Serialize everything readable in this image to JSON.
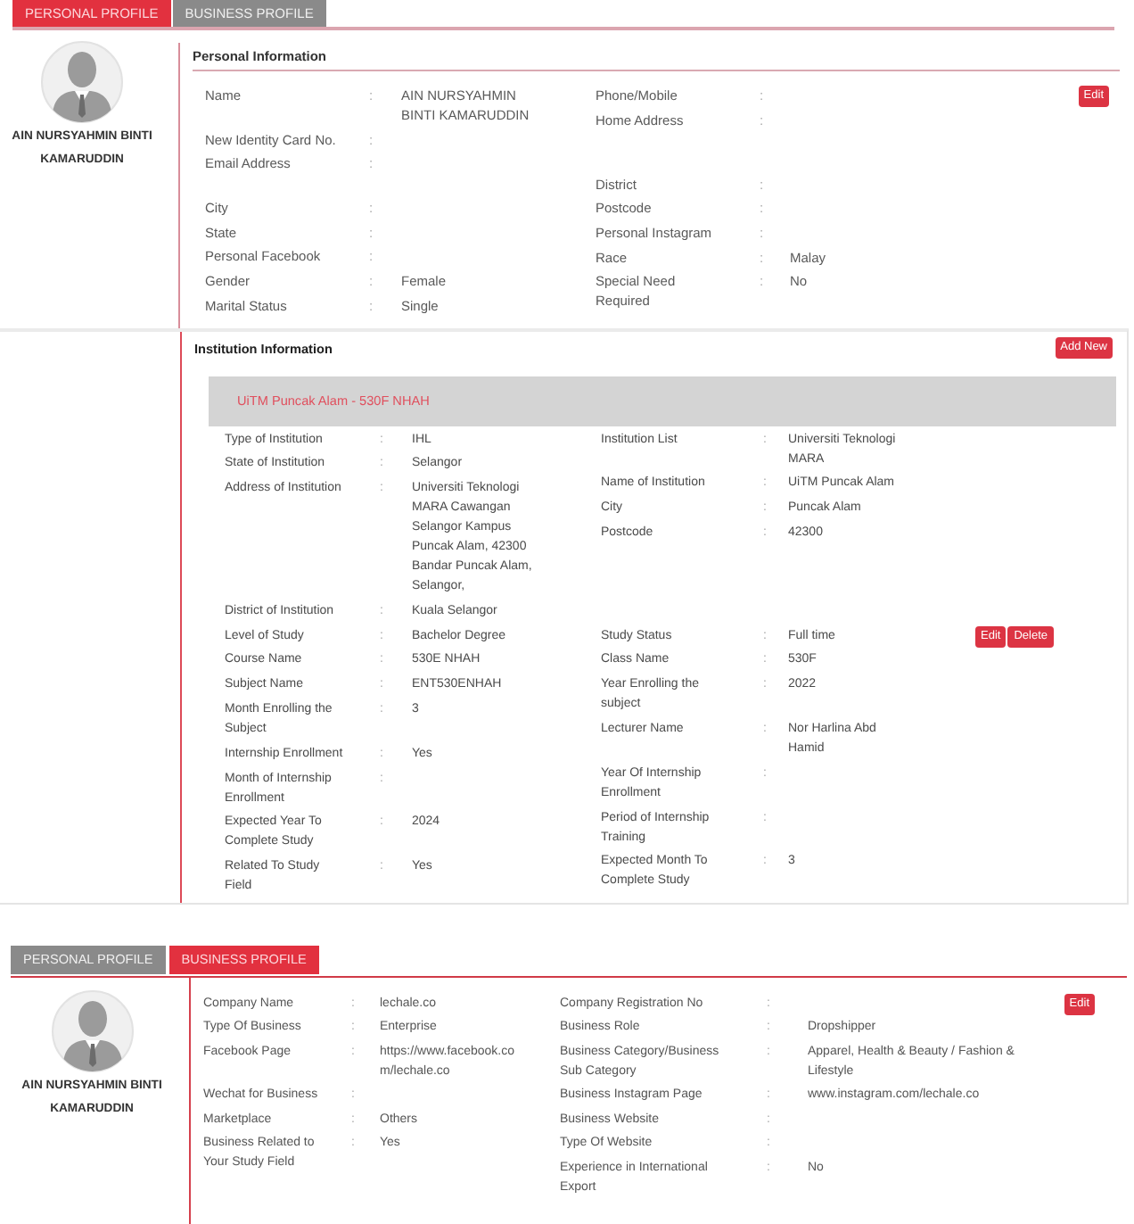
{
  "personal_profile": {
    "tabs": [
      {
        "label": "PERSONAL PROFILE",
        "selected": true
      },
      {
        "label": "BUSINESS PROFILE",
        "selected": false
      }
    ],
    "profile_name": "AIN NURSYAHMIN BINTI KAMARUDDIN",
    "section_title": "Personal Information",
    "edit_button": "Edit",
    "left_fields": [
      {
        "label": "Name",
        "sep": ":",
        "value": "AIN NURSYAHMIN BINTI KAMARUDDIN"
      },
      {
        "label": "New Identity Card No.",
        "sep": ":"
      },
      {
        "label": "Email Address",
        "sep": ":"
      },
      {
        "label": "City",
        "sep": ":"
      },
      {
        "label": "State",
        "sep": ":"
      },
      {
        "label": "Personal Facebook",
        "sep": ":"
      },
      {
        "label": "Gender",
        "sep": ":",
        "value": "Female"
      },
      {
        "label": "Marital Status",
        "sep": ":",
        "value": "Single"
      }
    ],
    "right_fields": [
      {
        "label": "Phone/Mobile",
        "sep": ":"
      },
      {
        "label": "Home Address",
        "sep": ":"
      },
      {
        "label": "District",
        "sep": ":"
      },
      {
        "label": "Postcode",
        "sep": ":"
      },
      {
        "label": "Personal Instagram",
        "sep": ":"
      },
      {
        "label": "Race",
        "sep": ":",
        "value": "Malay"
      },
      {
        "label": "Special Need Required",
        "sep": ":",
        "value": "No"
      }
    ]
  },
  "institution_information": {
    "title": "Institution Information",
    "add_button": "Add New",
    "record": {
      "heading": "UiTM Puncak Alam - 530F NHAH",
      "blocks": [
        {
          "left_fields": [
            {
              "label": "Type of Institution",
              "sep": ":",
              "value": "IHL"
            },
            {
              "label": "State of Institution",
              "sep": ":",
              "value": "Selangor"
            },
            {
              "label": "Address of Institution",
              "sep": ":",
              "value": "Universiti Teknologi MARA Cawangan Selangor Kampus Puncak Alam, 42300 Bandar Puncak Alam, Selangor,"
            },
            {
              "label": "District of Institution",
              "sep": ":",
              "value": "Kuala Selangor"
            }
          ],
          "right_fields": [
            {
              "label": "Institution List",
              "sep": ":",
              "value": "Universiti Teknologi MARA"
            },
            {
              "label": "Name of Institution",
              "sep": ":",
              "value": "UiTM Puncak Alam"
            },
            {
              "label": "City",
              "sep": ":",
              "value": "Puncak Alam"
            },
            {
              "label": "Postcode",
              "sep": ":",
              "value": "42300"
            }
          ]
        },
        {
          "left_fields": [
            {
              "label": "Level of Study",
              "sep": ":",
              "value": "Bachelor Degree"
            },
            {
              "label": "Course Name",
              "sep": ":",
              "value": "530E NHAH"
            },
            {
              "label": "Subject Name",
              "sep": ":",
              "value": "ENT530ENHAH"
            },
            {
              "label": "Month Enrolling the Subject",
              "sep": ":",
              "value": "3"
            },
            {
              "label": "Internship Enrollment",
              "sep": ":",
              "value": "Yes"
            },
            {
              "label": "Month of Internship Enrollment",
              "sep": ":"
            },
            {
              "label": "Expected Year To Complete Study",
              "sep": ":",
              "value": "2024"
            },
            {
              "label": "Related To Study Field",
              "sep": ":",
              "value": "Yes"
            }
          ],
          "right_fields": [
            {
              "label": "Study Status",
              "sep": ":",
              "value": "Full time"
            },
            {
              "label": "Class Name",
              "sep": ":",
              "value": "530F"
            },
            {
              "label": "Year Enrolling the subject",
              "sep": ":",
              "value": "2022"
            },
            {
              "label": "Lecturer Name",
              "sep": ":",
              "value": "Nor Harlina Abd Hamid"
            },
            {
              "label": "Year Of Internship Enrollment",
              "sep": ":"
            },
            {
              "label": "Period of Internship Training",
              "sep": ":"
            },
            {
              "label": "Expected Month To Complete Study",
              "sep": ":",
              "value": "3"
            }
          ],
          "actions": [
            {
              "kind": "edit",
              "label": "Edit"
            },
            {
              "kind": "delete",
              "label": "Delete"
            }
          ]
        }
      ]
    }
  },
  "business_profile": {
    "tabs": [
      {
        "label": "PERSONAL PROFILE",
        "selected": false
      },
      {
        "label": "BUSINESS PROFILE",
        "selected": true
      }
    ],
    "profile_name": "AIN NURSYAHMIN BINTI KAMARUDDIN",
    "edit_button": "Edit",
    "left_fields": [
      {
        "label": "Company Name",
        "sep": ":",
        "value": "lechale.co"
      },
      {
        "label": "Type Of Business",
        "sep": ":",
        "value": "Enterprise"
      },
      {
        "label": "Facebook Page",
        "sep": ":",
        "value": "https://www.facebook.com/lechale.co"
      },
      {
        "label": "Wechat for Business",
        "sep": ":"
      },
      {
        "label": "Marketplace",
        "sep": ":",
        "value": "Others"
      },
      {
        "label": "Business Related to Your Study Field",
        "sep": ":",
        "value": "Yes"
      }
    ],
    "right_fields": [
      {
        "label": "Company Registration No",
        "sep": ":"
      },
      {
        "label": "Business Role",
        "sep": ":",
        "value": "Dropshipper"
      },
      {
        "label": "Business Category/Business Sub Category",
        "sep": ":",
        "value": "Apparel, Health & Beauty / Fashion & Lifestyle"
      },
      {
        "label": "Business Instagram Page",
        "sep": ":",
        "value": "www.instagram.com/lechale.co"
      },
      {
        "label": "Business Website",
        "sep": ":"
      },
      {
        "label": "Type Of Website",
        "sep": ":"
      },
      {
        "label": "Experience in International Export",
        "sep": ":",
        "value": "No"
      }
    ]
  }
}
